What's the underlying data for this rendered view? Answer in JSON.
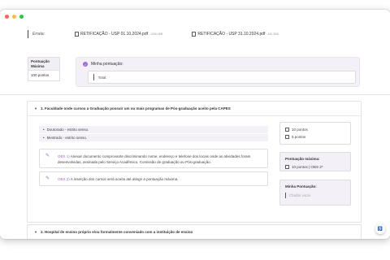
{
  "errata": {
    "label": "Errata:",
    "files": [
      {
        "name": "RETIFICAÇÃO - USP 01.10.2024.pdf",
        "size": "1006.9KB"
      },
      {
        "name": "RETIFICAÇÃO - USP 31.10.2024.pdf",
        "size": "442.3KB"
      }
    ]
  },
  "max_score": {
    "label": "Pontuação Máxima",
    "value": "100 pontos"
  },
  "my_score": {
    "title": "Minha pontuação:",
    "total_label": "Total:"
  },
  "sections": [
    {
      "title": "1. Faculdade onde cursou a Graduação possuir um ou mais programas de Pós-graduação aceito pela CAPES",
      "options": [
        "Doutorado - estrito senso.",
        "Mestrado - estrito senso."
      ],
      "obs": [
        {
          "tag": "OBS 1)",
          "text": "Anexar documento comprovante discriminando nome, endereço e telefone dos locais onde as atividades foram desenvolvidas, assinada pelo Serviço Acadêmico, Comissão de graduação ou Pós-graduação."
        },
        {
          "tag": "OBS 2)",
          "text": "A inserção dos cursos será aceita até atingir a pontuação máxima."
        }
      ],
      "checks": [
        "10 pontos",
        "5 pontos"
      ],
      "max_label": "Pontuação máxima:",
      "max_value": "10 pontos | OBS 2*",
      "my_label": "Minha Pontuação:",
      "my_placeholder": "Chatão vazia"
    },
    {
      "title": "2. Hospital de ensino próprio e/ou formalmente conveniado com a instituição de ensino"
    }
  ],
  "fab_icon": "accessibility-icon"
}
